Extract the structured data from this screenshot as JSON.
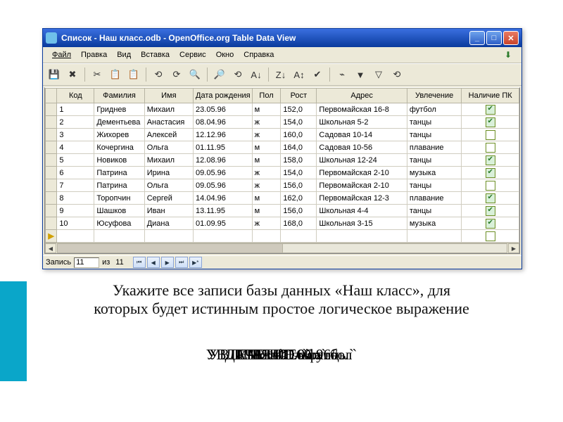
{
  "window": {
    "title": "Список - Наш класс.odb - OpenOffice.org Table Data View"
  },
  "menu": {
    "file": "Файл",
    "edit": "Правка",
    "view": "Вид",
    "insert": "Вставка",
    "tools": "Сервис",
    "window": "Окно",
    "help": "Справка"
  },
  "toolbar_icons": [
    "💾",
    "✖",
    "✂",
    "📋",
    "📋",
    "⟲",
    "⟳",
    "🔍",
    "🔎",
    "⟲",
    "A↓",
    "Z↓",
    "A↕",
    "✔",
    "⌁",
    "▼",
    "▽",
    "⟲"
  ],
  "columns": {
    "row": "",
    "code": "Код",
    "surname": "Фамилия",
    "name": "Имя",
    "birth": "Дата рождения",
    "sex": "Пол",
    "height": "Рост",
    "address": "Адрес",
    "hobby": "Увлечение",
    "pc": "Наличие ПК"
  },
  "rows": [
    {
      "code": "1",
      "surname": "Гриднев",
      "name": "Михаил",
      "birth": "23.05.96",
      "sex": "м",
      "height": "152,0",
      "address": "Первомайская 16-8",
      "hobby": "футбол",
      "pc": true
    },
    {
      "code": "2",
      "surname": "Дементьева",
      "name": "Анастасия",
      "birth": "08.04.96",
      "sex": "ж",
      "height": "154,0",
      "address": "Школьная 5-2",
      "hobby": "танцы",
      "pc": true
    },
    {
      "code": "3",
      "surname": "Жихорев",
      "name": "Алексей",
      "birth": "12.12.96",
      "sex": "ж",
      "height": "160,0",
      "address": "Садовая 10-14",
      "hobby": "танцы",
      "pc": false
    },
    {
      "code": "4",
      "surname": "Кочергина",
      "name": "Ольга",
      "birth": "01.11.95",
      "sex": "м",
      "height": "164,0",
      "address": "Садовая 10-56",
      "hobby": "плавание",
      "pc": false
    },
    {
      "code": "5",
      "surname": "Новиков",
      "name": "Михаил",
      "birth": "12.08.96",
      "sex": "м",
      "height": "158,0",
      "address": "Школьная 12-24",
      "hobby": "танцы",
      "pc": true
    },
    {
      "code": "6",
      "surname": "Патрина",
      "name": "Ирина",
      "birth": "09.05.96",
      "sex": "ж",
      "height": "154,0",
      "address": "Первомайская 2-10",
      "hobby": "музыка",
      "pc": true
    },
    {
      "code": "7",
      "surname": "Патрина",
      "name": "Ольга",
      "birth": "09.05.96",
      "sex": "ж",
      "height": "156,0",
      "address": "Первомайская 2-10",
      "hobby": "танцы",
      "pc": false
    },
    {
      "code": "8",
      "surname": "Торопчин",
      "name": "Сергей",
      "birth": "14.04.96",
      "sex": "м",
      "height": "162,0",
      "address": "Первомайская 12-3",
      "hobby": "плавание",
      "pc": true
    },
    {
      "code": "9",
      "surname": "Шашков",
      "name": "Иван",
      "birth": "13.11.95",
      "sex": "м",
      "height": "156,0",
      "address": "Школьная 4-4",
      "hobby": "танцы",
      "pc": true
    },
    {
      "code": "10",
      "surname": "Юсуфова",
      "name": "Диана",
      "birth": "01.09.95",
      "sex": "ж",
      "height": "168,0",
      "address": "Школьная 3-15",
      "hobby": "музыка",
      "pc": true
    }
  ],
  "nav": {
    "label_record": "Запись",
    "current": "11",
    "of_label": "из",
    "total": "11"
  },
  "caption_line1": "Укажите все записи базы данных «Наш класс», для",
  "caption_line2": "которых будет истинным простое логическое выражение",
  "expressions": [
    "ДАТА<#01.06.96#",
    "Рост>160",
    "ИМЯ=`Ольга`",
    "УВЛЕЧЕНИЕ=`футбол`",
    "УВЛЕЧЕНИЕ=`танцы`"
  ]
}
